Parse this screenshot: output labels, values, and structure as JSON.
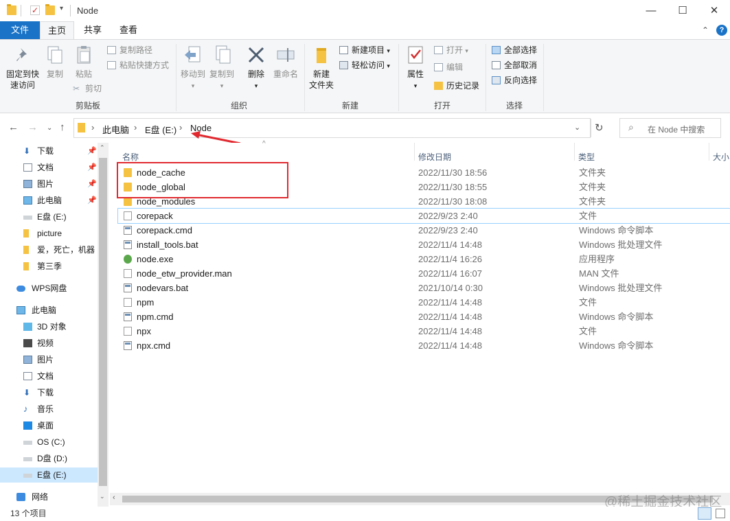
{
  "window": {
    "title": "Node",
    "controls": {
      "minimize": "—",
      "maximize": "☐",
      "close": "✕"
    }
  },
  "ribbon_tabs": [
    {
      "label": "文件"
    },
    {
      "label": "主页"
    },
    {
      "label": "共享"
    },
    {
      "label": "查看"
    }
  ],
  "ribbon": {
    "clipboard": {
      "label": "剪贴板",
      "pin_line1": "固定到快",
      "pin_line2": "速访问",
      "copy": "复制",
      "paste": "粘贴",
      "copy_path": "复制路径",
      "paste_shortcut": "粘贴快捷方式",
      "cut": "剪切"
    },
    "organize": {
      "label": "组织",
      "move_to": "移动到",
      "copy_to": "复制到",
      "delete": "删除",
      "rename": "重命名"
    },
    "new": {
      "label": "新建",
      "new_folder_line1": "新建",
      "new_folder_line2": "文件夹",
      "new_item": "新建项目",
      "easy_access": "轻松访问"
    },
    "open": {
      "label": "打开",
      "properties": "属性",
      "open": "打开",
      "edit": "编辑",
      "history": "历史记录"
    },
    "select": {
      "label": "选择",
      "select_all": "全部选择",
      "select_none": "全部取消",
      "invert": "反向选择"
    }
  },
  "address": {
    "crumbs": [
      "此电脑",
      "E盘 (E:)",
      "Node"
    ],
    "search_placeholder": "在 Node 中搜索"
  },
  "nav_pane": {
    "items": [
      {
        "label": "下载",
        "icon": "download-icon",
        "pinned": true
      },
      {
        "label": "文档",
        "icon": "document-icon",
        "pinned": true
      },
      {
        "label": "图片",
        "icon": "picture-icon",
        "pinned": true
      },
      {
        "label": "此电脑",
        "icon": "computer-icon",
        "pinned": true
      },
      {
        "label": "E盘 (E:)",
        "icon": "drive-icon",
        "pinned": false
      },
      {
        "label": "picture",
        "icon": "folder-icon",
        "pinned": false
      },
      {
        "label": "爱，死亡，机器",
        "icon": "folder-icon",
        "pinned": false
      },
      {
        "label": "第三季",
        "icon": "folder-icon",
        "pinned": false
      },
      {
        "label": "WPS网盘",
        "icon": "cloud-icon",
        "pinned": false
      },
      {
        "label": "此电脑",
        "icon": "computer-icon",
        "pinned": false
      },
      {
        "label": "3D 对象",
        "icon": "cube-icon",
        "pinned": false
      },
      {
        "label": "视频",
        "icon": "video-icon",
        "pinned": false
      },
      {
        "label": "图片",
        "icon": "picture-icon",
        "pinned": false
      },
      {
        "label": "文档",
        "icon": "document-icon",
        "pinned": false
      },
      {
        "label": "下载",
        "icon": "download-icon",
        "pinned": false
      },
      {
        "label": "音乐",
        "icon": "music-icon",
        "pinned": false
      },
      {
        "label": "桌面",
        "icon": "desktop-icon",
        "pinned": false
      },
      {
        "label": "OS (C:)",
        "icon": "drive-icon",
        "pinned": false
      },
      {
        "label": "D盘 (D:)",
        "icon": "drive-icon",
        "pinned": false
      },
      {
        "label": "E盘 (E:)",
        "icon": "drive-icon",
        "pinned": false
      },
      {
        "label": "网络",
        "icon": "network-icon",
        "pinned": false
      }
    ]
  },
  "columns": {
    "name": "名称",
    "date": "修改日期",
    "type": "类型",
    "size": "大小"
  },
  "files": [
    {
      "name": "node_cache",
      "date": "2022/11/30 18:56",
      "type": "文件夹",
      "icon": "folder"
    },
    {
      "name": "node_global",
      "date": "2022/11/30 18:55",
      "type": "文件夹",
      "icon": "folder"
    },
    {
      "name": "node_modules",
      "date": "2022/11/30 18:08",
      "type": "文件夹",
      "icon": "folder"
    },
    {
      "name": "corepack",
      "date": "2022/9/23 2:40",
      "type": "文件",
      "icon": "file"
    },
    {
      "name": "corepack.cmd",
      "date": "2022/9/23 2:40",
      "type": "Windows 命令脚本",
      "icon": "script"
    },
    {
      "name": "install_tools.bat",
      "date": "2022/11/4 14:48",
      "type": "Windows 批处理文件",
      "icon": "script"
    },
    {
      "name": "node.exe",
      "date": "2022/11/4 16:26",
      "type": "应用程序",
      "icon": "exe"
    },
    {
      "name": "node_etw_provider.man",
      "date": "2022/11/4 16:07",
      "type": "MAN 文件",
      "icon": "file"
    },
    {
      "name": "nodevars.bat",
      "date": "2021/10/14 0:30",
      "type": "Windows 批处理文件",
      "icon": "script"
    },
    {
      "name": "npm",
      "date": "2022/11/4 14:48",
      "type": "文件",
      "icon": "file"
    },
    {
      "name": "npm.cmd",
      "date": "2022/11/4 14:48",
      "type": "Windows 命令脚本",
      "icon": "script"
    },
    {
      "name": "npx",
      "date": "2022/11/4 14:48",
      "type": "文件",
      "icon": "file"
    },
    {
      "name": "npx.cmd",
      "date": "2022/11/4 14:48",
      "type": "Windows 命令脚本",
      "icon": "script"
    }
  ],
  "status": {
    "item_count": "13 个项目"
  },
  "watermark": "@稀土掘金技术社区",
  "colors": {
    "accent": "#1a73c7",
    "selection": "#cce8ff",
    "annotation": "#e0282e"
  }
}
